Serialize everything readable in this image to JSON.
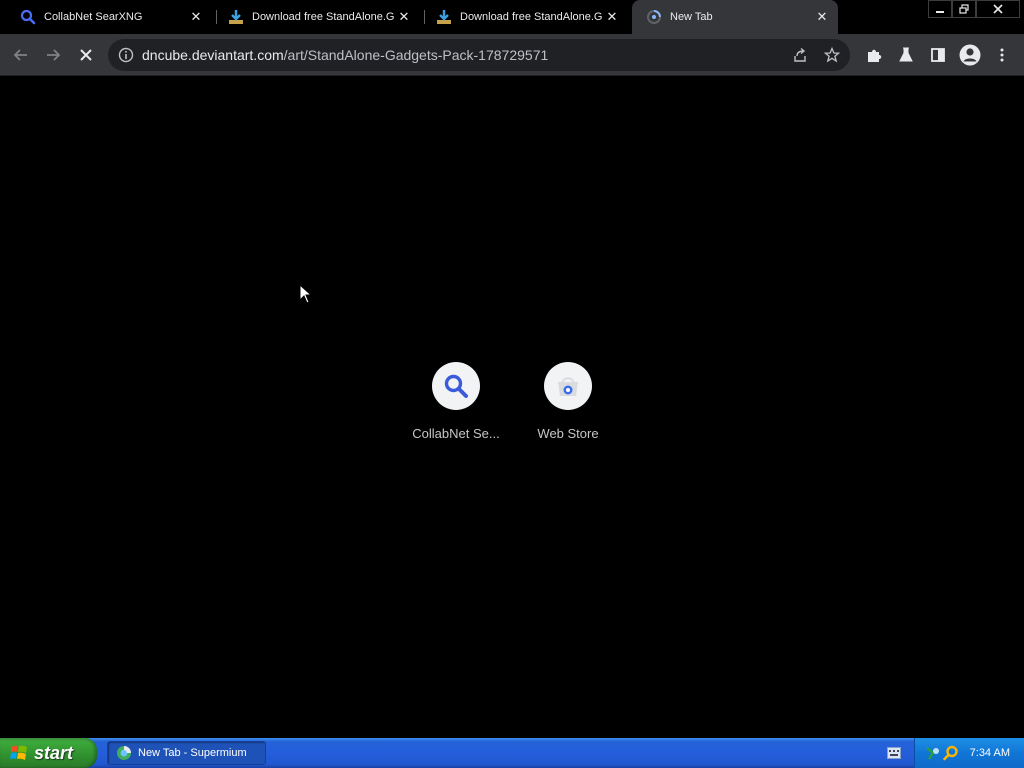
{
  "tabs": [
    {
      "title": "CollabNet SearXNG",
      "active": false,
      "icon": "search-icon"
    },
    {
      "title": "Download free StandAlone.G",
      "active": false,
      "icon": "download-icon"
    },
    {
      "title": "Download free StandAlone.G",
      "active": false,
      "icon": "download-icon"
    },
    {
      "title": "New Tab",
      "active": true,
      "icon": "loading-icon"
    }
  ],
  "toolbar": {
    "url_host": "dncube.deviantart.com",
    "url_path": "/art/StandAlone-Gadgets-Pack-178729571"
  },
  "shortcuts": [
    {
      "label": "CollabNet Se...",
      "icon": "search-icon"
    },
    {
      "label": "Web Store",
      "icon": "web-store-icon"
    }
  ],
  "taskbar": {
    "start_label": "start",
    "task_label": "New Tab - Supermium",
    "clock": "7:34 AM"
  },
  "colors": {
    "page_bg": "#000000",
    "toolbar_bg": "#35363a",
    "accent_blue": "#3b5bdb",
    "taskbar_blue": "#245edb",
    "start_green": "#3ba83a"
  }
}
